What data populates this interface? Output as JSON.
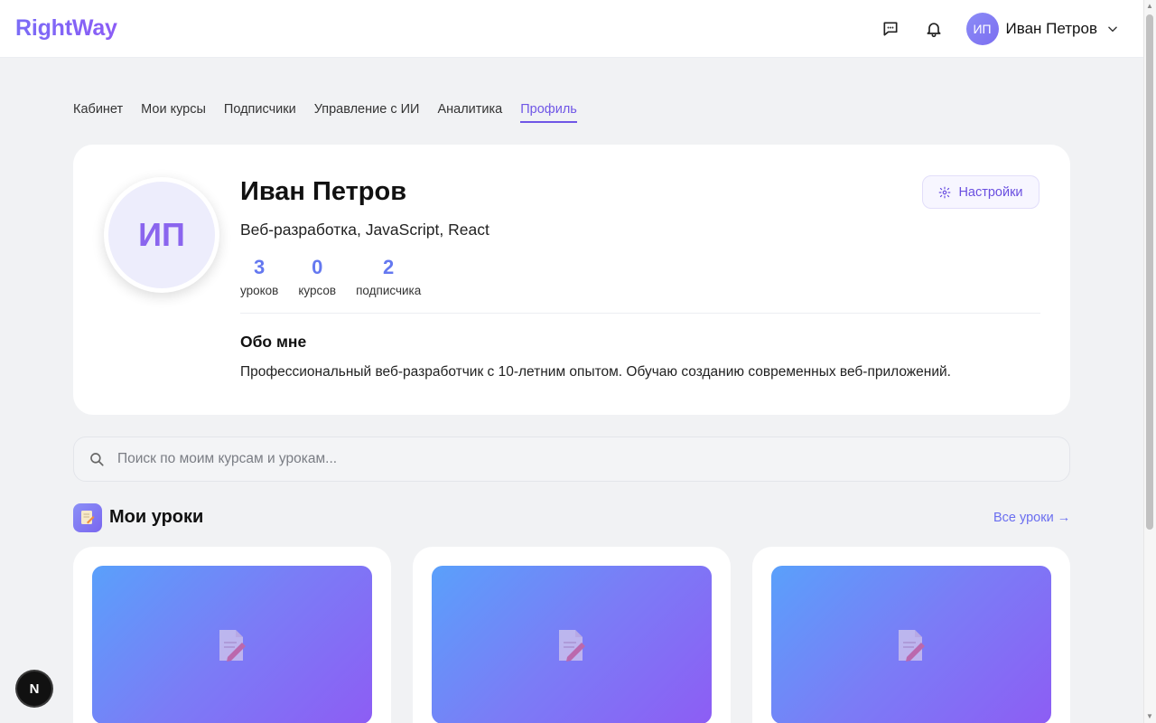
{
  "header": {
    "logo": "RightWay",
    "user_initials": "ИП",
    "user_name": "Иван Петров"
  },
  "tabs": [
    {
      "label": "Кабинет",
      "active": false
    },
    {
      "label": "Мои курсы",
      "active": false
    },
    {
      "label": "Подписчики",
      "active": false
    },
    {
      "label": "Управление с ИИ",
      "active": false
    },
    {
      "label": "Аналитика",
      "active": false
    },
    {
      "label": "Профиль",
      "active": true
    }
  ],
  "profile": {
    "initials": "ИП",
    "name": "Иван Петров",
    "tags": "Веб-разработка, JavaScript, React",
    "settings_label": "Настройки",
    "stats": [
      {
        "value": "3",
        "label": "уроков"
      },
      {
        "value": "0",
        "label": "курсов"
      },
      {
        "value": "2",
        "label": "подписчика"
      }
    ],
    "about_title": "Обо мне",
    "about_text": "Профессиональный веб-разработчик с 10-летним опытом. Обучаю созданию современных веб-приложений."
  },
  "search": {
    "placeholder": "Поиск по моим курсам и урокам...",
    "value": ""
  },
  "lessons_section": {
    "title": "Мои уроки",
    "all_link": "Все уроки →",
    "cards": [
      {
        "icon": "memo-icon"
      },
      {
        "icon": "memo-icon"
      },
      {
        "icon": "memo-icon"
      }
    ]
  },
  "floating_badge": {
    "label": "N"
  },
  "colors": {
    "accent": "#6f56e6",
    "stat_value": "#6478f0",
    "thumb_gradient_start": "#5aa0fb",
    "thumb_gradient_end": "#8d5df4"
  }
}
